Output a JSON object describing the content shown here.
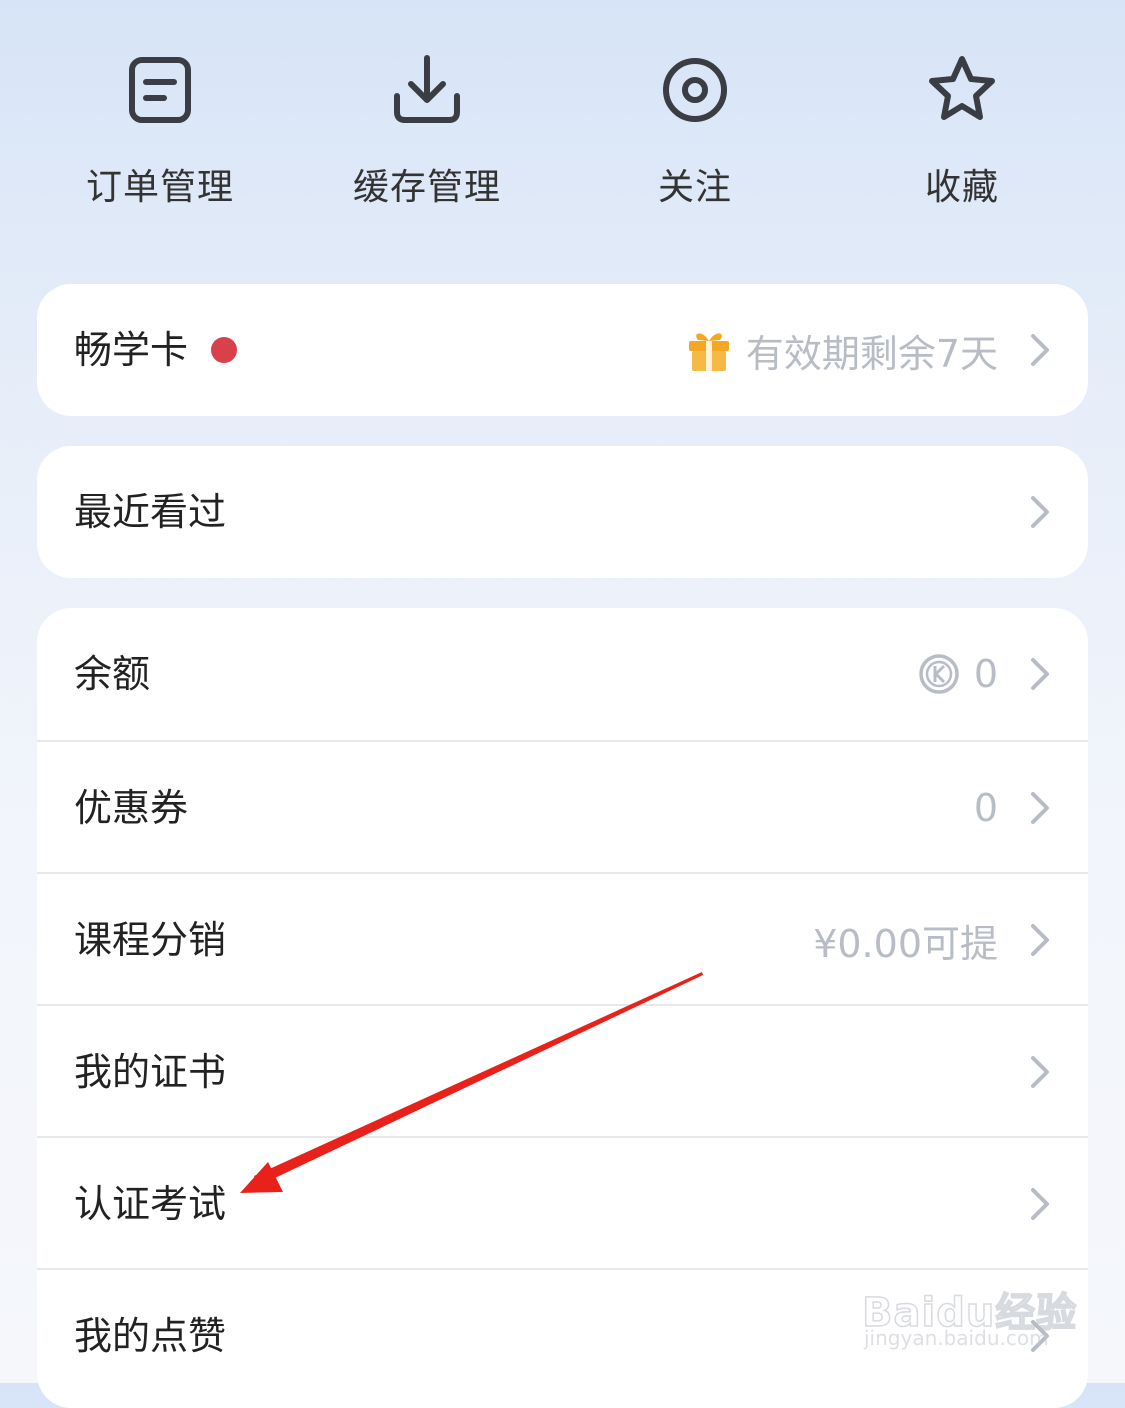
{
  "quick_actions": [
    {
      "label": "订单管理",
      "icon": "order-list-icon"
    },
    {
      "label": "缓存管理",
      "icon": "download-icon"
    },
    {
      "label": "关注",
      "icon": "follow-target-icon"
    },
    {
      "label": "收藏",
      "icon": "star-icon"
    }
  ],
  "vip_card": {
    "label": "畅学卡",
    "status": "有效期剩余7天",
    "dot_color": "#d9414a",
    "gift_color": "#f5a623"
  },
  "recent": {
    "label": "最近看过"
  },
  "account_items": [
    {
      "label": "余额",
      "value": "0",
      "icon": "k-coin-icon"
    },
    {
      "label": "优惠券",
      "value": "0"
    },
    {
      "label": "课程分销",
      "value": "¥0.00可提"
    },
    {
      "label": "我的证书",
      "value": ""
    },
    {
      "label": "认证考试",
      "value": ""
    },
    {
      "label": "我的点赞",
      "value": ""
    }
  ],
  "watermark": {
    "brand": "Baidu经验",
    "url": "jingyan.baidu.com"
  },
  "colors": {
    "accent_red": "#e8221b",
    "muted_text": "#b8bcc4",
    "icon_stroke": "#3a3d44"
  }
}
